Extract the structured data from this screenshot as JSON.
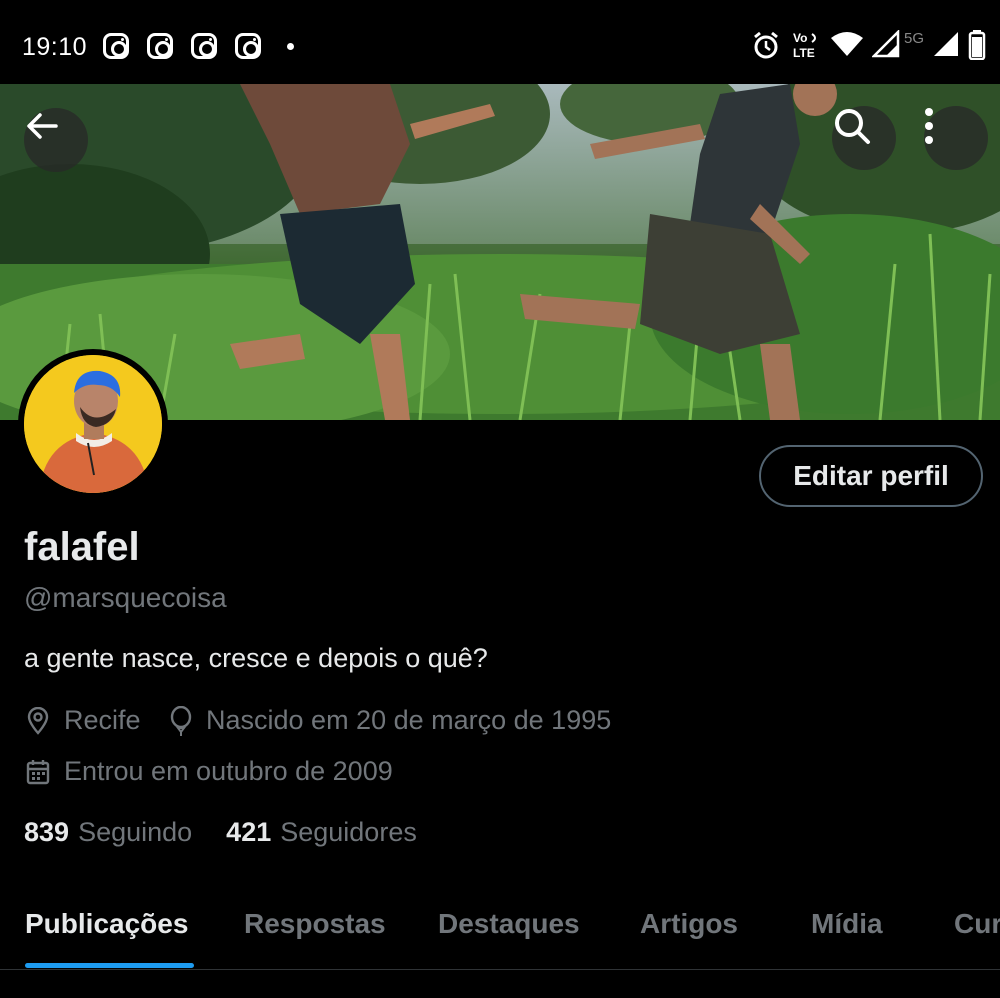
{
  "status_bar": {
    "time": "19:10",
    "notification_icons": [
      "instagram-icon",
      "instagram-icon",
      "instagram-icon",
      "instagram-icon"
    ],
    "network": "5G"
  },
  "profile": {
    "name": "falafel",
    "handle": "@marsquecoisa",
    "bio": "a gente nasce, cresce e depois o quê?",
    "location": "Recife",
    "birth": "Nascido em 20 de março de 1995",
    "joined": "Entrou em outubro de 2009",
    "following_count": "839",
    "following_label": "Seguindo",
    "followers_count": "421",
    "followers_label": "Seguidores",
    "edit_label": "Editar perfil"
  },
  "tabs": [
    {
      "label": "Publicações",
      "active": true
    },
    {
      "label": "Respostas"
    },
    {
      "label": "Destaques"
    },
    {
      "label": "Artigos"
    },
    {
      "label": "Mídia"
    },
    {
      "label": "Cur"
    }
  ],
  "colors": {
    "accent": "#1d9bf0",
    "muted": "#71767b",
    "text": "#e7e9ea",
    "background": "#000000"
  }
}
